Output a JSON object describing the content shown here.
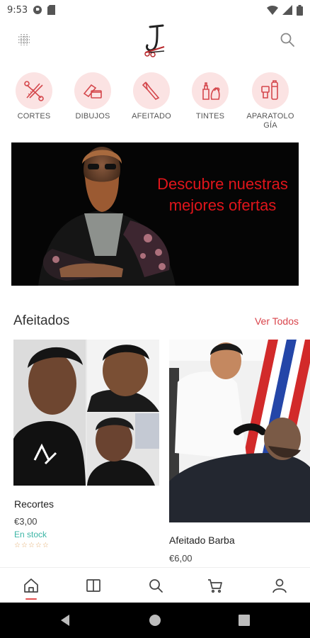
{
  "status_bar": {
    "time": "9:53"
  },
  "categories": [
    {
      "label": "CORTES",
      "icon": "scissors-comb-icon"
    },
    {
      "label": "DIBUJOS",
      "icon": "razor-cream-icon"
    },
    {
      "label": "AFEITADO",
      "icon": "straight-razor-icon"
    },
    {
      "label": "TINTES",
      "icon": "dye-bottle-icon"
    },
    {
      "label": "APARATOLOGÍA",
      "label_lines": [
        "APARATOLO",
        "GÍA"
      ],
      "icon": "clipper-devices-icon"
    }
  ],
  "banner": {
    "lines": [
      "Descubre nuestras",
      "mejores ofertas"
    ]
  },
  "section": {
    "title": "Afeitados",
    "view_all": "Ver Todos"
  },
  "products": [
    {
      "name": "Recortes",
      "price": "€3,00",
      "stock": "En stock",
      "rating": 0,
      "rating_max": 5
    },
    {
      "name": "Afeitado Barba",
      "price": "€6,00"
    }
  ],
  "bottom_nav": [
    {
      "name": "home",
      "icon": "home-icon",
      "active": true
    },
    {
      "name": "catalog",
      "icon": "book-icon"
    },
    {
      "name": "search",
      "icon": "search-icon"
    },
    {
      "name": "cart",
      "icon": "cart-icon"
    },
    {
      "name": "account",
      "icon": "user-icon"
    }
  ],
  "colors": {
    "accent": "#e35050",
    "banner_text": "#e0151b",
    "category_bg": "#fbe3e3",
    "stock": "#3bb5a5"
  }
}
